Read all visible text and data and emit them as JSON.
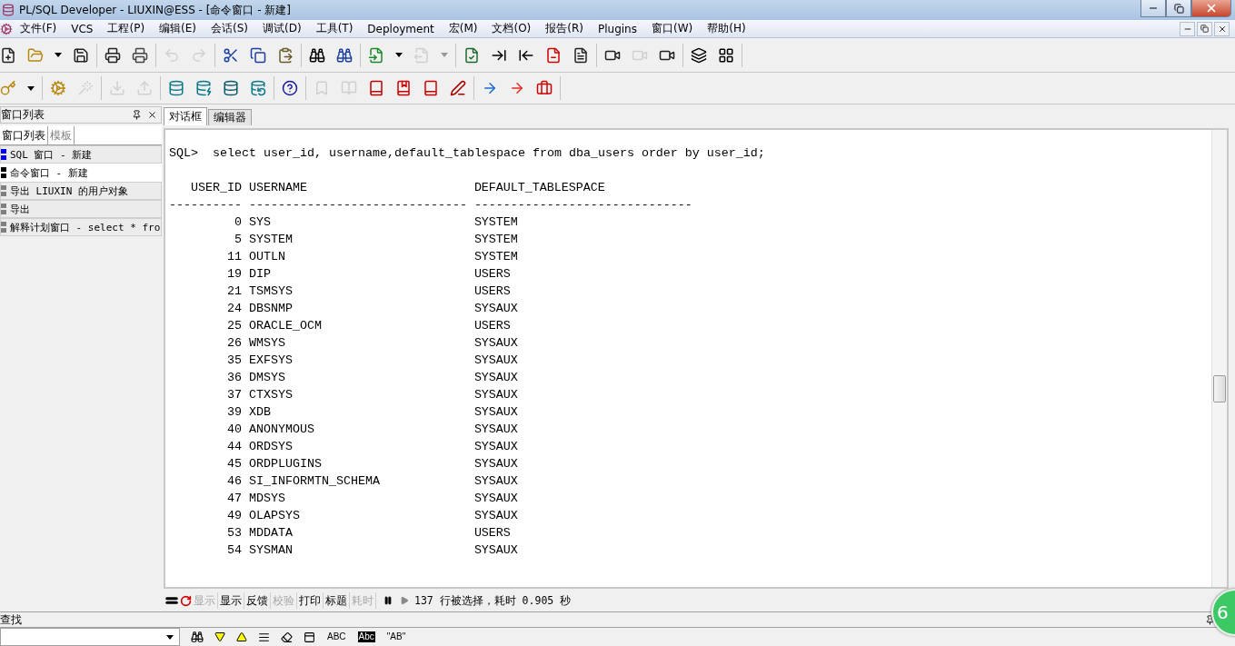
{
  "window": {
    "title": "PL/SQL Developer - LIUXIN@ESS - [命令窗口 - 新建]"
  },
  "menu": [
    "文件(F)",
    "VCS",
    "工程(P)",
    "编辑(E)",
    "会话(S)",
    "调试(D)",
    "工具(T)",
    "Deployment",
    "宏(M)",
    "文档(O)",
    "报告(R)",
    "Plugins",
    "窗口(W)",
    "帮助(H)"
  ],
  "toolbar_1": {
    "groups": [
      [
        {
          "kind": "button",
          "disabled": false
        },
        {
          "kind": "button",
          "disabled": false
        },
        {
          "kind": "caret",
          "disabled": false
        },
        {
          "kind": "button",
          "disabled": false
        }
      ],
      [
        {
          "kind": "button",
          "disabled": false
        },
        {
          "kind": "button",
          "disabled": false
        }
      ],
      [
        {
          "kind": "button",
          "disabled": true
        },
        {
          "kind": "button",
          "disabled": true
        }
      ],
      [
        {
          "kind": "button",
          "disabled": false
        },
        {
          "kind": "button",
          "disabled": false
        },
        {
          "kind": "button",
          "disabled": false
        }
      ],
      [
        {
          "kind": "button",
          "disabled": false
        },
        {
          "kind": "button",
          "disabled": false
        }
      ],
      [
        {
          "kind": "button",
          "disabled": false
        },
        {
          "kind": "caret",
          "disabled": false
        },
        {
          "kind": "button",
          "disabled": true
        },
        {
          "kind": "caret",
          "disabled": true
        }
      ],
      [
        {
          "kind": "button",
          "disabled": false
        },
        {
          "kind": "button",
          "disabled": false
        },
        {
          "kind": "button",
          "disabled": false
        },
        {
          "kind": "button",
          "disabled": false
        },
        {
          "kind": "button",
          "disabled": false
        }
      ],
      [
        {
          "kind": "button",
          "disabled": false
        },
        {
          "kind": "button",
          "disabled": true
        },
        {
          "kind": "button",
          "disabled": false
        }
      ],
      [
        {
          "kind": "button",
          "disabled": false
        },
        {
          "kind": "button",
          "disabled": false
        }
      ]
    ]
  },
  "toolbar_2": {
    "groups": [
      [
        {
          "kind": "button",
          "disabled": false
        },
        {
          "kind": "caret",
          "disabled": false
        }
      ],
      [
        {
          "kind": "button",
          "disabled": false
        },
        {
          "kind": "button",
          "disabled": true
        }
      ],
      [
        {
          "kind": "button",
          "disabled": true
        },
        {
          "kind": "button",
          "disabled": true
        }
      ],
      [
        {
          "kind": "button",
          "disabled": false
        },
        {
          "kind": "button",
          "disabled": false
        },
        {
          "kind": "button",
          "disabled": false
        },
        {
          "kind": "button",
          "disabled": false
        }
      ],
      [
        {
          "kind": "button",
          "disabled": false
        }
      ],
      [
        {
          "kind": "button",
          "disabled": true
        },
        {
          "kind": "button",
          "disabled": true
        },
        {
          "kind": "button",
          "disabled": false
        },
        {
          "kind": "button",
          "disabled": false
        },
        {
          "kind": "button",
          "disabled": false
        },
        {
          "kind": "button",
          "disabled": false
        }
      ],
      [
        {
          "kind": "button",
          "disabled": false
        },
        {
          "kind": "button",
          "disabled": false
        },
        {
          "kind": "button",
          "disabled": false
        }
      ]
    ]
  },
  "left_panel": {
    "title": "窗口列表",
    "tabs": [
      {
        "label": "窗口列表",
        "selected": true
      },
      {
        "label": "模板",
        "selected": false
      }
    ],
    "items": [
      {
        "label": "SQL 窗口 - 新建",
        "color": "#0000ff",
        "selected": false
      },
      {
        "label": "命令窗口 - 新建",
        "color": "#000000",
        "selected": true
      },
      {
        "label": "导出 LIUXIN 的用户对象",
        "color": "#808080",
        "selected": false
      },
      {
        "label": "导出",
        "color": "#808080",
        "selected": false
      },
      {
        "label": "解释计划窗口 - select * fro",
        "color": "#808080",
        "selected": false
      }
    ]
  },
  "editor": {
    "tabs": [
      {
        "label": "对话框",
        "selected": true
      },
      {
        "label": "编辑器",
        "selected": false
      }
    ],
    "prompt": "SQL>",
    "command": "select user_id, username,default_tablespace from dba_users order by user_id;",
    "columns": [
      "USER_ID",
      "USERNAME",
      "DEFAULT_TABLESPACE"
    ],
    "separators": [
      "----------",
      "------------------------------",
      "------------------------------"
    ],
    "rows": [
      [
        "0",
        "SYS",
        "SYSTEM"
      ],
      [
        "5",
        "SYSTEM",
        "SYSTEM"
      ],
      [
        "11",
        "OUTLN",
        "SYSTEM"
      ],
      [
        "19",
        "DIP",
        "USERS"
      ],
      [
        "21",
        "TSMSYS",
        "USERS"
      ],
      [
        "24",
        "DBSNMP",
        "SYSAUX"
      ],
      [
        "25",
        "ORACLE_OCM",
        "USERS"
      ],
      [
        "26",
        "WMSYS",
        "SYSAUX"
      ],
      [
        "35",
        "EXFSYS",
        "SYSAUX"
      ],
      [
        "36",
        "DMSYS",
        "SYSAUX"
      ],
      [
        "37",
        "CTXSYS",
        "SYSAUX"
      ],
      [
        "39",
        "XDB",
        "SYSAUX"
      ],
      [
        "40",
        "ANONYMOUS",
        "SYSAUX"
      ],
      [
        "44",
        "ORDSYS",
        "SYSAUX"
      ],
      [
        "45",
        "ORDPLUGINS",
        "SYSAUX"
      ],
      [
        "46",
        "SI_INFORMTN_SCHEMA",
        "SYSAUX"
      ],
      [
        "47",
        "MDSYS",
        "SYSAUX"
      ],
      [
        "49",
        "OLAPSYS",
        "SYSAUX"
      ],
      [
        "53",
        "MDDATA",
        "USERS"
      ],
      [
        "54",
        "SYSMAN",
        "SYSAUX"
      ]
    ]
  },
  "status_bar": {
    "buttons": [
      {
        "label": "显示",
        "disabled": true
      },
      {
        "label": "显示",
        "disabled": false
      },
      {
        "label": "反馈",
        "disabled": false
      },
      {
        "label": "校验",
        "disabled": true
      },
      {
        "label": "打印",
        "disabled": false
      },
      {
        "label": "标题",
        "disabled": false
      },
      {
        "label": "耗时",
        "disabled": true
      }
    ],
    "message": "137 行被选择，耗时 0.905 秒"
  },
  "find_panel": {
    "title": "查找",
    "text_buttons": [
      {
        "label": "ABC",
        "kind": "plain"
      },
      {
        "label": "Abc",
        "kind": "inverted"
      },
      {
        "label": "\"AB\"",
        "kind": "plain"
      }
    ]
  },
  "overlay_badge": {
    "text": "6"
  }
}
